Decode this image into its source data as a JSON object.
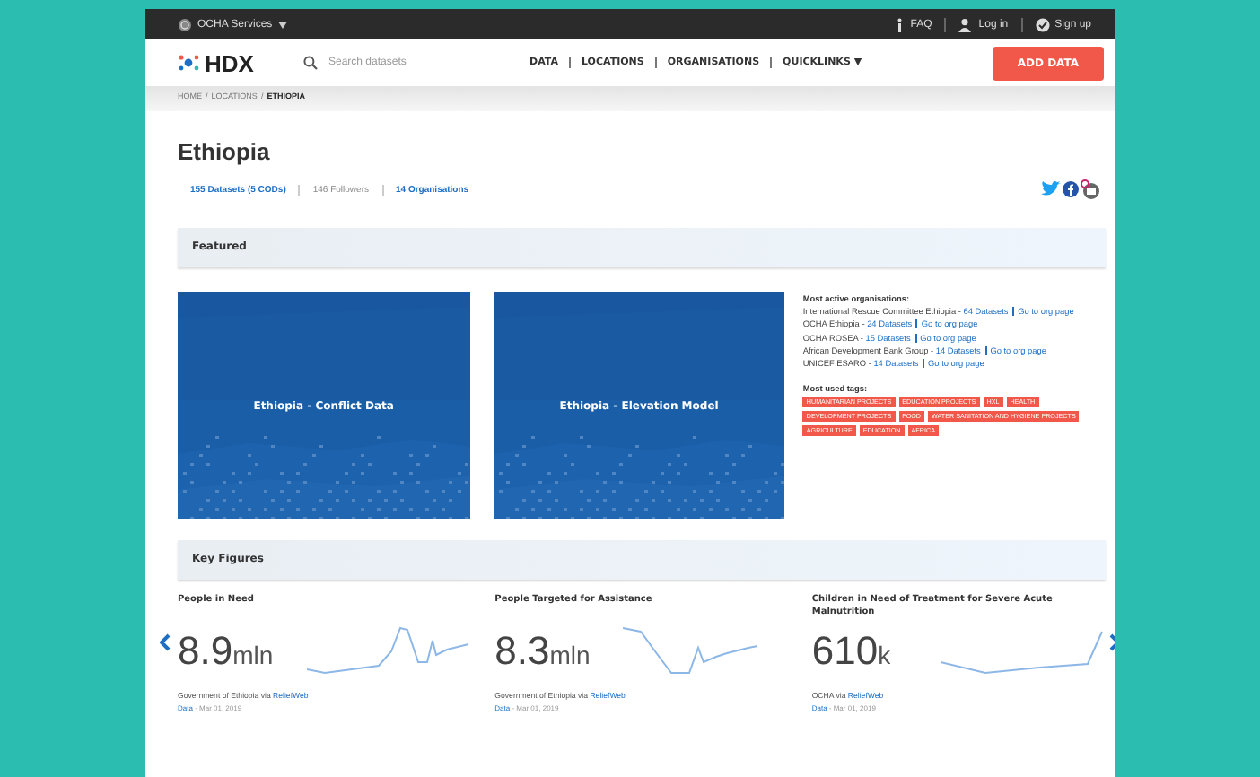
{
  "top_bar": {
    "services": "OCHA Services",
    "links": [
      {
        "label": "FAQ"
      },
      {
        "label": "Log in"
      },
      {
        "label": "Sign up"
      }
    ]
  },
  "header": {
    "logo": "HDX",
    "search": {
      "placeholder": "Search datasets"
    },
    "nav": [
      {
        "label": "DATA"
      },
      {
        "label": "LOCATIONS"
      },
      {
        "label": "ORGANISATIONS"
      },
      {
        "label": "QUICKLINKS",
        "caret": "▼"
      }
    ],
    "action": "ADD DATA"
  },
  "breadcrumb": {
    "separator": "/",
    "items": [
      {
        "label": "HOME",
        "selected": false
      },
      {
        "label": "LOCATIONS",
        "selected": false
      },
      {
        "label": "ETHIOPIA",
        "selected": true
      }
    ]
  },
  "location": {
    "title": "Ethiopia",
    "stats": [
      {
        "text": "155 Datasets (5 CODs)",
        "kind": "link"
      },
      {
        "text": "146 Followers",
        "kind": "plain"
      },
      {
        "text": "14 Organisations",
        "kind": "link"
      }
    ]
  },
  "featured": {
    "heading": "Featured",
    "cards": [
      {
        "title": "Ethiopia - Conflict Data"
      },
      {
        "title": "Ethiopia - Elevation Model"
      }
    ],
    "orgs_heading": "Most active organisations:",
    "orgs": [
      {
        "name": "International Rescue Committee Ethiopia -",
        "datasets": "64 Datasets",
        "page": "Go to org page"
      },
      {
        "name": "OCHA Ethiopia -",
        "datasets": "24 Datasets",
        "page": "Go to org page"
      },
      {
        "name": "OCHA ROSEA -",
        "datasets": "15 Datasets",
        "page": "Go to org page"
      },
      {
        "name": "African Development Bank Group -",
        "datasets": "14 Datasets",
        "page": "Go to org page"
      },
      {
        "name": "UNICEF ESARO -",
        "datasets": "14 Datasets",
        "page": "Go to org page"
      }
    ],
    "tags_heading": "Most used tags:",
    "tags": [
      "HUMANITARIAN PROJECTS",
      "EDUCATION PROJECTS",
      "HXL",
      "HEALTH",
      "DEVELOPMENT PROJECTS",
      "FOOD",
      "WATER SANITATION AND HYGIENE PROJECTS",
      "AGRICULTURE",
      "EDUCATION",
      "AFRICA"
    ]
  },
  "key_figures": {
    "heading": "Key Figures",
    "items": [
      {
        "title": "People in Need",
        "value": "8.9",
        "unit": "mln",
        "source": "Government of Ethiopia via",
        "source_link": "ReliefWeb",
        "date_link": "Data",
        "date": "- Mar 01, 2019"
      },
      {
        "title": "People Targeted for Assistance",
        "value": "8.3",
        "unit": "mln",
        "source": "Government of Ethiopia via",
        "source_link": "ReliefWeb",
        "date_link": "Data",
        "date": "- Mar 01, 2019"
      },
      {
        "title": "Children in Need of Treatment for Severe Acute Malnutrition",
        "value": "610",
        "unit": "k",
        "source": "OCHA via",
        "source_link": "ReliefWeb",
        "date_link": "Data",
        "date": "- Mar 01, 2019"
      }
    ]
  }
}
